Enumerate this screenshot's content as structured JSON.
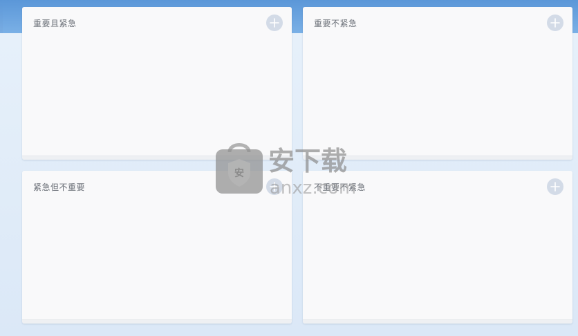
{
  "quadrants": {
    "important_urgent": {
      "title": "重要且紧急"
    },
    "important_not_urgent": {
      "title": "重要不紧急"
    },
    "urgent_not_important": {
      "title": "紧急但不重要"
    },
    "not_important_not_urgent": {
      "title": "不重要不紧急"
    }
  },
  "icons": {
    "add": "plus-circle-icon"
  },
  "watermark": {
    "brand_cn": "安下载",
    "brand_en": "anxz.com",
    "badge": "安"
  },
  "colors": {
    "header_top": "#5b97d8",
    "background": "#dce9f8",
    "card": "#f9f9fa",
    "add_button": "#d3dbe7",
    "title_text": "#6a6f77"
  }
}
